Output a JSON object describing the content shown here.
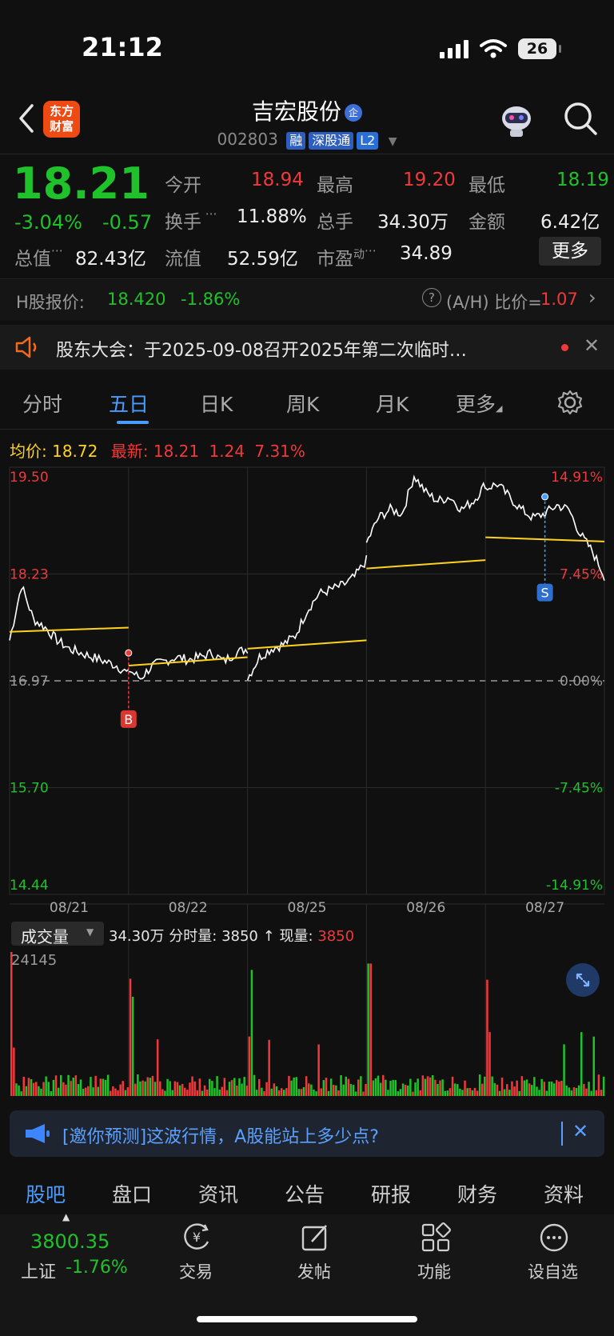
{
  "status_bar": {
    "time": "21:12",
    "battery": "26"
  },
  "header": {
    "logo_line1": "东方",
    "logo_line2": "财富",
    "stock_name": "吉宏股份",
    "company_badge": "企",
    "stock_code": "002803",
    "tags": [
      "融",
      "深股通",
      "L2"
    ]
  },
  "quote": {
    "last_price": "18.21",
    "pct_change": "-3.04%",
    "amt_change": "-0.57",
    "open_label": "今开",
    "open_value": "18.94",
    "high_label": "最高",
    "high_value": "19.20",
    "low_label": "最低",
    "low_value": "18.19",
    "turnover_label": "换手",
    "turnover_value": "11.88%",
    "volume_label": "总手",
    "volume_value": "34.30万",
    "amount_label": "金额",
    "amount_value": "6.42亿",
    "total_mv_label": "总值",
    "total_mv_value": "82.43亿",
    "float_mv_label": "流值",
    "float_mv_value": "52.59亿",
    "pe_label": "市盈",
    "pe_superscript": "动",
    "pe_value": "34.89",
    "more_label": "更多"
  },
  "h_share": {
    "label": "H股报价:",
    "price": "18.420",
    "change": "-1.86%",
    "ratio_label": "(A/H) 比价=",
    "ratio_value": "1.07"
  },
  "announcement": {
    "text": "股东大会：于2025-09-08召开2025年第二次临时…"
  },
  "tabs": [
    "分时",
    "五日",
    "日K",
    "周K",
    "月K",
    "更多"
  ],
  "active_tab": "五日",
  "chart_info": {
    "avg_label": "均价:",
    "avg_value": "18.72",
    "latest_label": "最新:",
    "latest_value": "18.21",
    "latest_change": "1.24",
    "latest_pct": "7.31%",
    "y_left_labels": [
      "19.50",
      "18.23",
      "16.97",
      "15.70",
      "14.44"
    ],
    "y_right_labels": [
      "14.91%",
      "7.45%",
      "0.00%",
      "-7.45%",
      "-14.91%"
    ],
    "x_labels": [
      "08/21",
      "08/22",
      "08/25",
      "08/26",
      "08/27"
    ],
    "buy_marker": "B",
    "sell_marker": "S"
  },
  "chart_data": {
    "type": "line",
    "title": "",
    "x": [
      "08/21",
      "08/22",
      "08/25",
      "08/26",
      "08/27"
    ],
    "series": [
      {
        "name": "",
        "values": [
          17.4,
          17.25,
          17.7,
          18.7,
          18.21
        ]
      },
      {
        "name": "均价",
        "values": [
          17.55,
          17.2,
          17.4,
          18.35,
          18.72
        ]
      }
    ],
    "ylim": [
      14.44,
      19.5
    ],
    "base_price": 16.97,
    "y_secondary_labels": [
      "14.91%",
      "7.45%",
      "0.00%",
      "-7.45%",
      "-14.91%"
    ],
    "grid": true
  },
  "volume": {
    "selector_label": "成交量",
    "total": "34.30万",
    "minute_label": "分时量:",
    "minute_value": "3850",
    "arrow": "↑",
    "current_label": "现量:",
    "current_value": "3850",
    "max_label": "24145"
  },
  "promo": {
    "text": "[邀你预测]这波行情，A股能站上多少点?"
  },
  "bottom_tabs": [
    "股吧",
    "盘口",
    "资讯",
    "公告",
    "研报",
    "财务",
    "资料"
  ],
  "bottom_bar": {
    "index_value": "3800.35",
    "index_name": "上证",
    "index_change": "-1.76%",
    "items": [
      "交易",
      "发帖",
      "功能",
      "设自选"
    ]
  },
  "colors": {
    "up": "#f0393a",
    "down": "#1fc22a",
    "accent": "#4a9cff",
    "avg_line": "#ffd21f"
  }
}
